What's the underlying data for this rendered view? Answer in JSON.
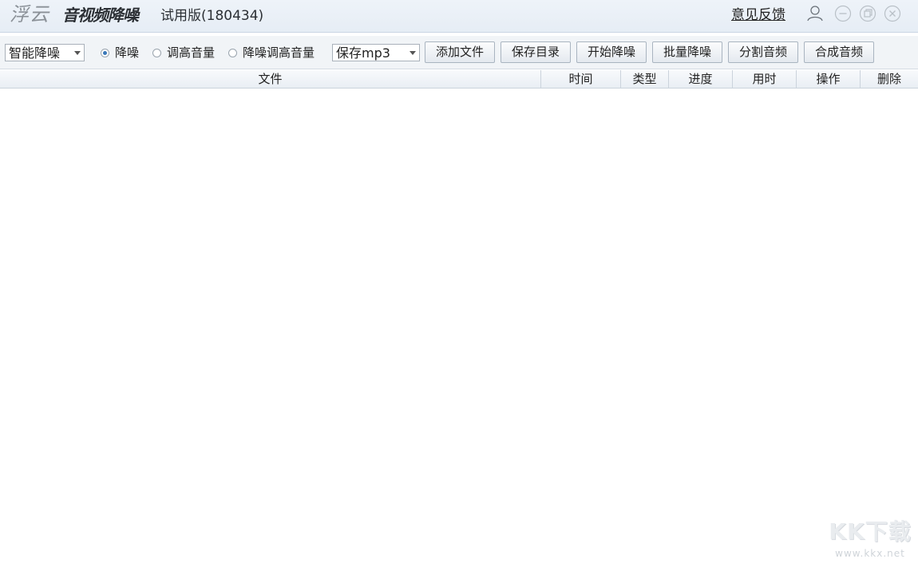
{
  "titlebar": {
    "brand": "浮云",
    "product": "音视频降噪",
    "edition": "试用版(180434)",
    "feedback_link": "意见反馈",
    "icons": {
      "user": "user-icon",
      "minimize": "minimize-icon",
      "restore": "restore-icon",
      "close": "close-icon"
    }
  },
  "toolbar": {
    "mode_select": {
      "selected": "智能降噪"
    },
    "radios": [
      {
        "label": "降噪",
        "checked": true
      },
      {
        "label": "调高音量",
        "checked": false
      },
      {
        "label": "降噪调高音量",
        "checked": false
      }
    ],
    "format_select": {
      "selected": "保存mp3"
    },
    "buttons": {
      "add_file": "添加文件",
      "save_dir": "保存目录",
      "start_denoise": "开始降噪",
      "batch_denoise": "批量降噪",
      "split_audio": "分割音频",
      "merge_audio": "合成音频"
    }
  },
  "table": {
    "columns": [
      "文件",
      "时间",
      "类型",
      "进度",
      "用时",
      "操作",
      "删除"
    ],
    "rows": []
  },
  "watermark": {
    "text": "KK下载",
    "url": "www.kkx.net"
  },
  "colors": {
    "radio_accent": "#3a78b9",
    "titlebar_bg": "#e6edf5",
    "toolbar_bg": "#f1f4f7"
  }
}
